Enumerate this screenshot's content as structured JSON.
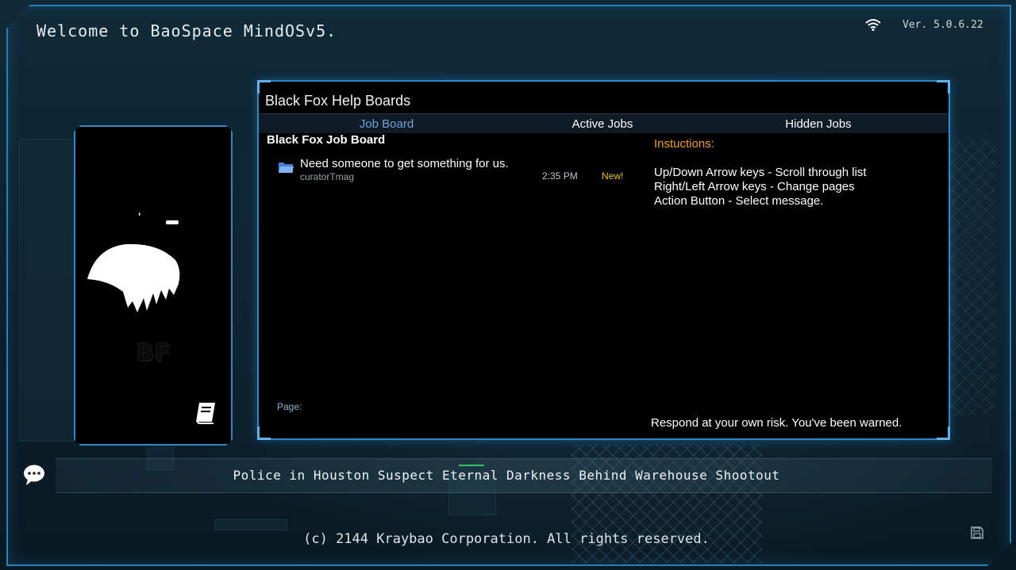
{
  "header": {
    "welcome": "Welcome to BaoSpace MindOSv5.",
    "version": "Ver. 5.0.6.22",
    "wifi_icon": "wifi-icon"
  },
  "profile_card": {
    "avatar": "black-fox-avatar",
    "logo_text": "BF",
    "book_icon": "book-icon"
  },
  "board": {
    "title": "Black Fox Help Boards",
    "tabs": [
      {
        "label": "Job Board",
        "active": true
      },
      {
        "label": "Active Jobs",
        "active": false
      },
      {
        "label": "Hidden Jobs",
        "active": false
      }
    ],
    "heading": "Black Fox Job Board",
    "jobs": [
      {
        "icon": "folder-icon",
        "title": "Need someone to get something for us.",
        "author": "curatorTmag",
        "time": "2:35 PM",
        "badge": "New!"
      }
    ],
    "instructions_title": "Instuctions:",
    "instructions": [
      "Up/Down Arrow keys - Scroll through list",
      "Right/Left Arrow keys - Change pages",
      "Action Button - Select message."
    ],
    "page_label": "Page:",
    "warning": "Respond at your own risk.  You've been warned."
  },
  "ticker": {
    "chat_icon": "chat-icon",
    "headline": "Police in Houston Suspect Eternal Darkness Behind Warehouse Shootout"
  },
  "footer": {
    "copyright": "(c) 2144 Kraybao Corporation.  All rights reserved.",
    "save_icon": "save-icon"
  },
  "colors": {
    "frame": "#2b7fb8",
    "active_tab": "#6aa2dc",
    "instructions_title": "#f0a020",
    "new_badge": "#e7c23a"
  }
}
